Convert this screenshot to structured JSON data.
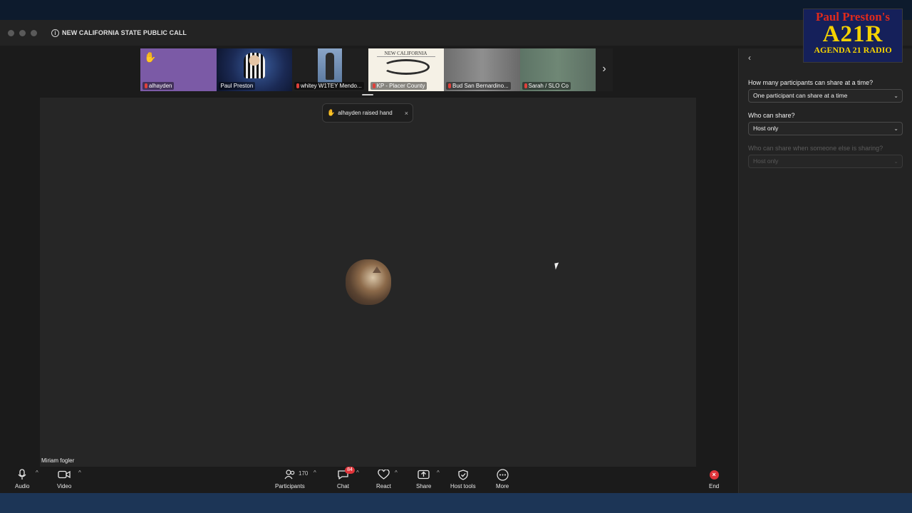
{
  "window": {
    "title": "NEW CALIFORNIA STATE PUBLIC CALL"
  },
  "logo": {
    "line1": "Paul Preston's",
    "line2": "A21R",
    "line3": "AGENDA 21 RADIO"
  },
  "participants_strip": [
    {
      "name": "alhayden",
      "muted": true,
      "hand_raised": true
    },
    {
      "name": "Paul Preston",
      "muted": false
    },
    {
      "name": "whitey  W1TEY Mendo...",
      "muted": true
    },
    {
      "name": "KP - Placer County",
      "muted": true,
      "banner": "NEW CALIFORNIA"
    },
    {
      "name": "Bud   San Bernardino...",
      "muted": true
    },
    {
      "name": "Sarah / SLO Co",
      "muted": true
    }
  ],
  "notification": {
    "text": "alhayden raised hand",
    "close": "×"
  },
  "stage": {
    "speaker_name": "Miriam fogler"
  },
  "toolbar": {
    "audio": "Audio",
    "video": "Video",
    "participants": "Participants",
    "participant_count": "170",
    "chat": "Chat",
    "chat_badge": "84",
    "react": "React",
    "share": "Share",
    "host_tools": "Host tools",
    "more": "More",
    "end": "End"
  },
  "share_settings": {
    "q1": "How many participants can share at a time?",
    "q1_value": "One participant can share at a time",
    "q2": "Who can share?",
    "q2_value": "Host only",
    "q3": "Who can share when someone else is sharing?",
    "q3_value": "Host only",
    "q3_disabled": true
  },
  "colors": {
    "end_red": "#e0343a",
    "window_bg": "#1b1b1b",
    "stage_bg": "#262626"
  }
}
